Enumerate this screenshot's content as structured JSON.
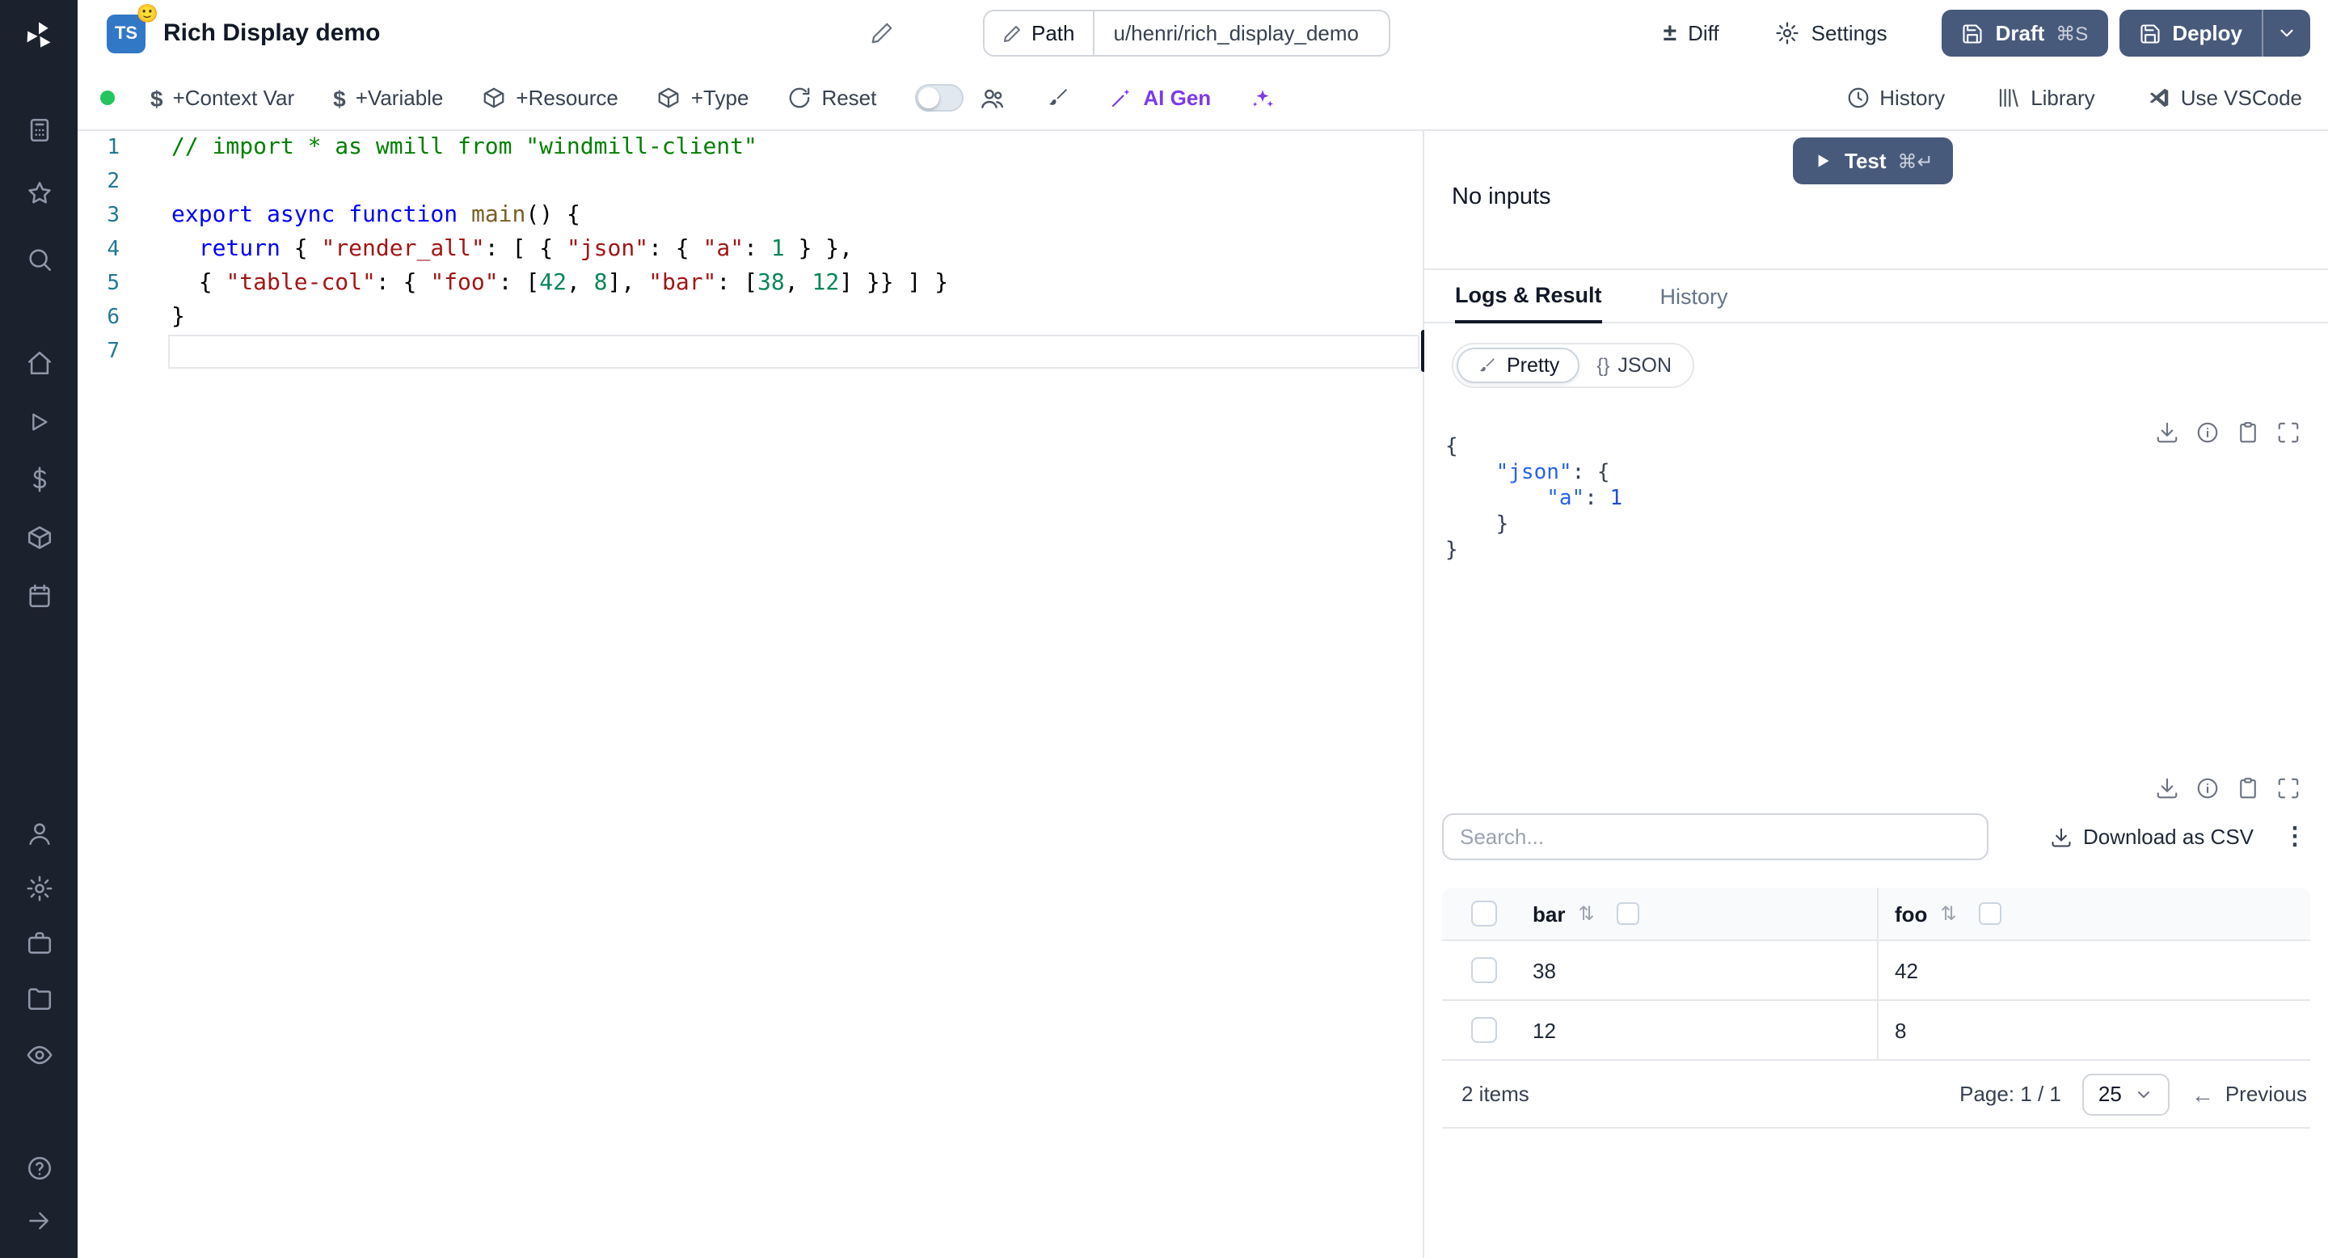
{
  "colors": {
    "button_dark": "#485a7c",
    "ai_purple": "#7c3aed",
    "ts_blue": "#3178c6",
    "status_green": "#22c55e"
  },
  "icons": {
    "dollar": "$",
    "diff": "±",
    "kebab": "⋮",
    "braces": "{}",
    "sort": "⇅",
    "arrow_left": "←"
  },
  "header": {
    "title": "Rich Display demo",
    "lang": "TS",
    "emoji": "🙂",
    "path_label": "Path",
    "path_value": "u/henri/rich_display_demo",
    "diff": "Diff",
    "settings": "Settings",
    "draft": "Draft",
    "draft_shortcut": "⌘S",
    "deploy": "Deploy"
  },
  "toolbar": {
    "context_var": "+Context Var",
    "variable": "+Variable",
    "resource": "+Resource",
    "type": "+Type",
    "reset": "Reset",
    "ai_gen": "AI Gen",
    "history": "History",
    "library": "Library",
    "vscode": "Use VSCode"
  },
  "editor": {
    "lines": [
      [
        [
          "c",
          "// import * as wmill from \"windmill-client\""
        ]
      ],
      [],
      [
        [
          "k",
          "export"
        ],
        [
          "p",
          " "
        ],
        [
          "k",
          "async"
        ],
        [
          "p",
          " "
        ],
        [
          "k",
          "function"
        ],
        [
          "p",
          " "
        ],
        [
          "f",
          "main"
        ],
        [
          "p",
          "() {"
        ]
      ],
      [
        [
          "p",
          "  "
        ],
        [
          "k",
          "return"
        ],
        [
          "p",
          " { "
        ],
        [
          "s",
          "\"render_all\""
        ],
        [
          "p",
          ": [ { "
        ],
        [
          "s",
          "\"json\""
        ],
        [
          "p",
          ": { "
        ],
        [
          "s",
          "\"a\""
        ],
        [
          "p",
          ": "
        ],
        [
          "n",
          "1"
        ],
        [
          "p",
          " } },"
        ]
      ],
      [
        [
          "p",
          "  { "
        ],
        [
          "s",
          "\"table-col\""
        ],
        [
          "p",
          ": { "
        ],
        [
          "s",
          "\"foo\""
        ],
        [
          "p",
          ": ["
        ],
        [
          "n",
          "42"
        ],
        [
          "p",
          ", "
        ],
        [
          "n",
          "8"
        ],
        [
          "p",
          "], "
        ],
        [
          "s",
          "\"bar\""
        ],
        [
          "p",
          ": ["
        ],
        [
          "n",
          "38"
        ],
        [
          "p",
          ", "
        ],
        [
          "n",
          "12"
        ],
        [
          "p",
          "] }} ] }"
        ]
      ],
      [
        [
          "p",
          "}"
        ]
      ],
      []
    ]
  },
  "panel": {
    "no_inputs": "No inputs",
    "test": "Test",
    "test_shortcut": "⌘↵",
    "tab_logs": "Logs & Result",
    "tab_history": "History",
    "pretty": "Pretty",
    "json": "JSON",
    "result_lines": [
      [
        [
          "p",
          "{"
        ]
      ],
      [
        [
          "p",
          "    "
        ],
        [
          "k",
          "\"json\""
        ],
        [
          "p",
          ": {"
        ]
      ],
      [
        [
          "p",
          "        "
        ],
        [
          "k",
          "\"a\""
        ],
        [
          "p",
          ": "
        ],
        [
          "n",
          "1"
        ]
      ],
      [
        [
          "p",
          "    }"
        ]
      ],
      [
        [
          "p",
          "}"
        ]
      ]
    ]
  },
  "table": {
    "search_placeholder": "Search...",
    "download_csv": "Download as CSV",
    "columns": [
      "bar",
      "foo"
    ],
    "rows": [
      [
        "38",
        "42"
      ],
      [
        "12",
        "8"
      ]
    ],
    "items_label": "2 items",
    "page_label": "Page: 1 / 1",
    "page_size": "25",
    "previous": "Previous"
  }
}
